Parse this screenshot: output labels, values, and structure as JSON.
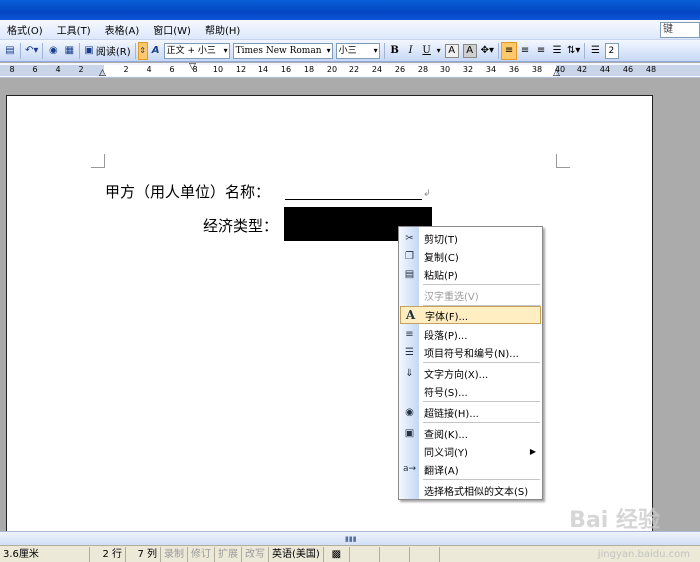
{
  "menubar": {
    "items": [
      "格式(O)",
      "工具(T)",
      "表格(A)",
      "窗口(W)",
      "帮助(H)"
    ],
    "right_box": "键"
  },
  "toolbar": {
    "read_label": "阅读(R)",
    "style_value": "正文 + 小三",
    "font_value": "Times New Roman",
    "size_value": "小三",
    "bold": "B",
    "italic": "I",
    "underline": "U",
    "char_border": "A",
    "char_shade": "A",
    "right_box": "2"
  },
  "ruler": {
    "ticks": [
      "8",
      "6",
      "4",
      "2",
      "2",
      "4",
      "6",
      "8",
      "10",
      "12",
      "14",
      "16",
      "18",
      "20",
      "22",
      "24",
      "26",
      "28",
      "30",
      "32",
      "34",
      "36",
      "38",
      "40",
      "42",
      "44",
      "46",
      "48"
    ]
  },
  "document": {
    "line1_label": "甲方（用人单位）名称：",
    "line2_label": "经济类型："
  },
  "context_menu": {
    "items": [
      {
        "label": "剪切(T)",
        "icon": "scissors-icon",
        "disabled": false
      },
      {
        "label": "复制(C)",
        "icon": "copy-icon",
        "disabled": false
      },
      {
        "label": "粘贴(P)",
        "icon": "paste-icon",
        "disabled": false
      },
      {
        "label": "汉字重选(V)",
        "icon": "",
        "disabled": true
      },
      {
        "label": "字体(F)...",
        "icon": "font-icon",
        "disabled": false,
        "highlighted": true
      },
      {
        "label": "段落(P)...",
        "icon": "paragraph-icon",
        "disabled": false
      },
      {
        "label": "项目符号和编号(N)...",
        "icon": "bullets-icon",
        "disabled": false
      },
      {
        "label": "文字方向(X)...",
        "icon": "text-direction-icon",
        "disabled": false
      },
      {
        "label": "符号(S)...",
        "icon": "",
        "disabled": false
      },
      {
        "label": "超链接(H)...",
        "icon": "hyperlink-icon",
        "disabled": false
      },
      {
        "label": "查阅(K)...",
        "icon": "lookup-icon",
        "disabled": false
      },
      {
        "label": "同义词(Y)",
        "icon": "",
        "disabled": false,
        "submenu": true
      },
      {
        "label": "翻译(A)",
        "icon": "translate-icon",
        "disabled": false
      },
      {
        "label": "选择格式相似的文本(S)",
        "icon": "",
        "disabled": false
      }
    ]
  },
  "statusbar": {
    "position": "3.6厘米",
    "line": "2 行",
    "column": "7 列",
    "rec": "录制",
    "trk": "修订",
    "ext": "扩展",
    "ovr": "改写",
    "language": "英语(美国)"
  },
  "watermark": {
    "logo": "Bai 经验",
    "url": "jingyan.baidu.com"
  }
}
